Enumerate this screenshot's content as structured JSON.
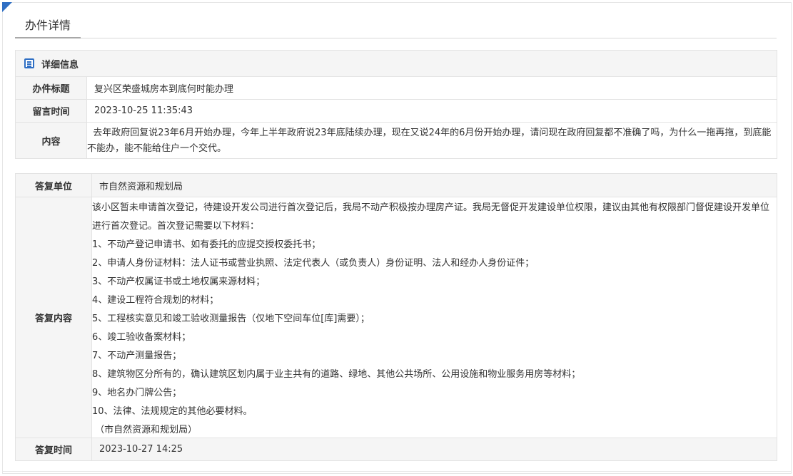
{
  "page_title": "办件详情",
  "detail": {
    "section_title": "详细信息",
    "labels": {
      "title": "办件标题",
      "time": "留言时间",
      "content": "内容"
    },
    "title": "复兴区荣盛城房本到底何时能办理",
    "time": "2023-10-25 11:35:43",
    "content": "  去年政府回复说23年6月开始办理，今年上半年政府说23年底陆续办理，现在又说24年的6月份开始办理，请问现在政府回复都不准确了吗，为什么一拖再拖，到底能不能办，能不能给住户一个交代。"
  },
  "reply": {
    "labels": {
      "unit": "答复单位",
      "content": "答复内容",
      "time": "答复时间"
    },
    "unit": "市自然资源和规划局",
    "lines": [
      "该小区暂未申请首次登记，待建设开发公司进行首次登记后，我局不动产积极按办理房产证。我局无督促开发建设单位权限，建议由其他有权限部门督促建设开发单位",
      "进行首次登记。首次登记需要以下材料：",
      "1、不动产登记申请书、如有委托的应提交授权委托书；",
      "2、申请人身份证材料：法人证书或营业执照、法定代表人（或负责人）身份证明、法人和经办人身份证件；",
      "3、不动产权属证书或土地权属来源材料；",
      "4、建设工程符合规划的材料；",
      "5、工程核实意见和竣工验收测量报告（仅地下空间车位[库]需要）；",
      "6、竣工验收备案材料；",
      "7、不动产测量报告；",
      "8、建筑物区分所有的，确认建筑区划内属于业主共有的道路、绿地、其他公共场所、公用设施和物业服务用房等材料；",
      "9、地名办门牌公告；",
      "10、法律、法规规定的其他必要材料。",
      " （市自然资源和规划局）"
    ],
    "time": "2023-10-27 14:25"
  },
  "colors": {
    "accent": "#2f6fc4",
    "label_bg": "#f5f5f5",
    "border": "#e3e3e3"
  }
}
